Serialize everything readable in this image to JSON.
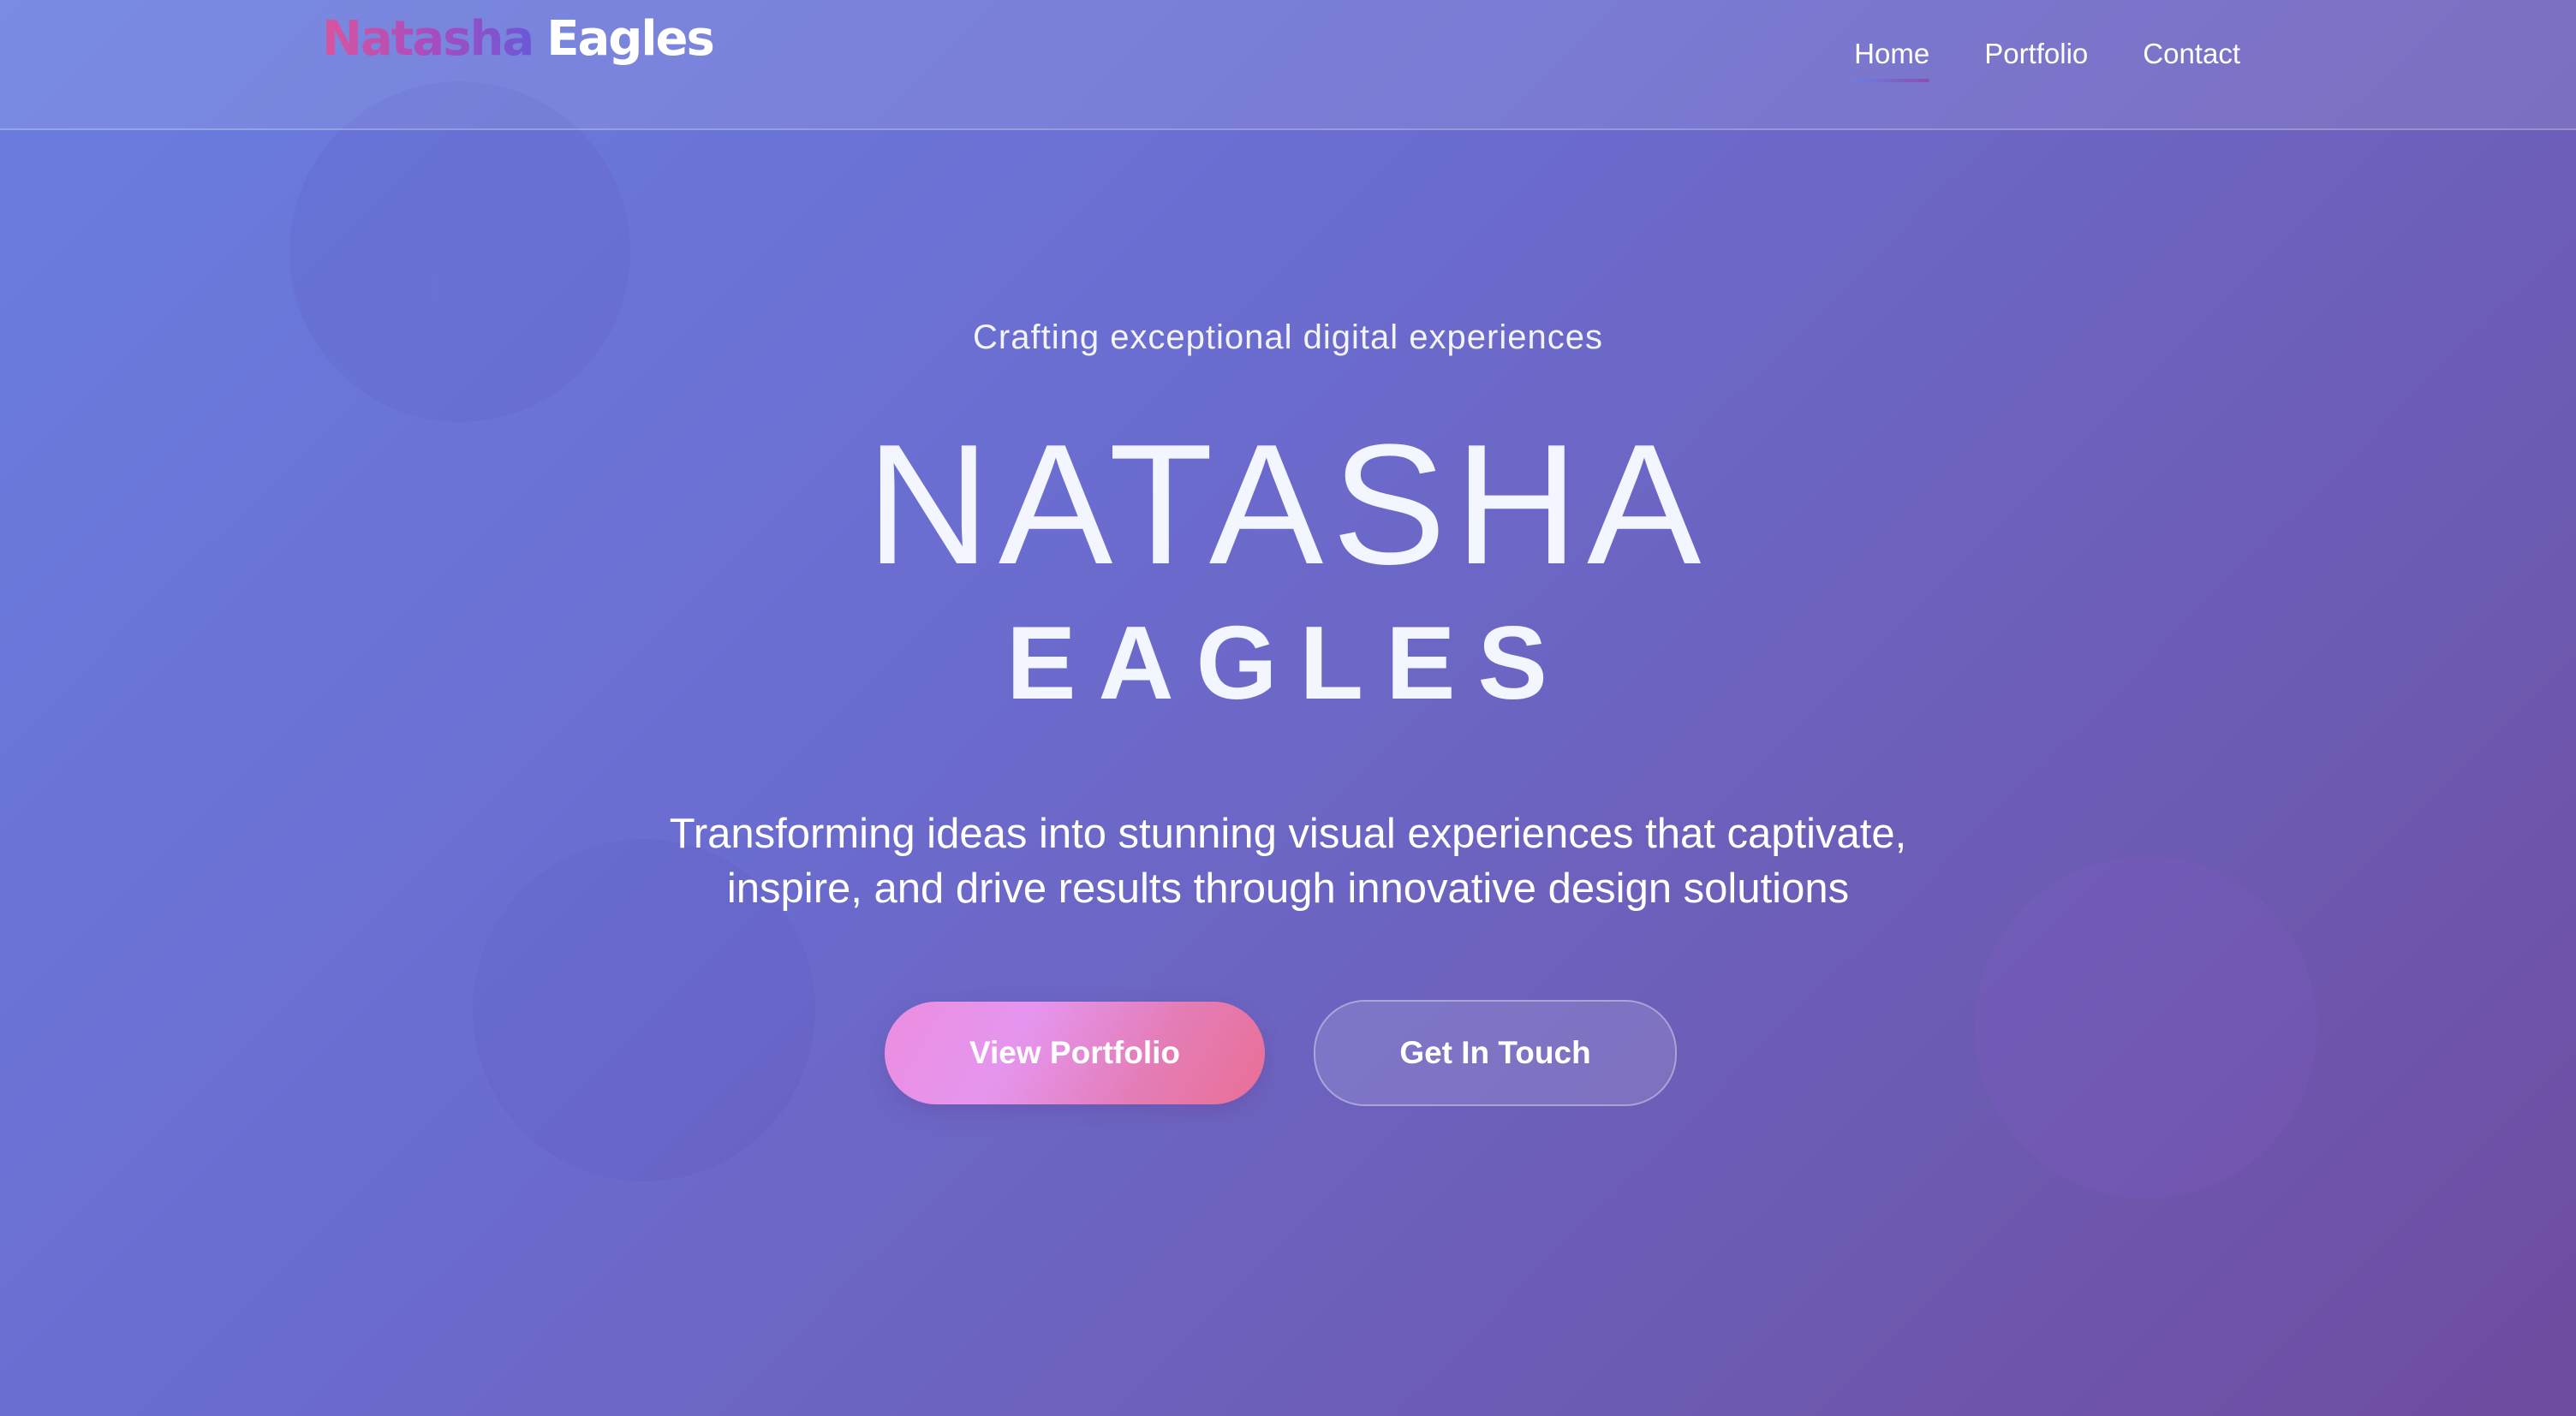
{
  "header": {
    "logo_first": "Natasha",
    "logo_last": "Eagles",
    "nav": [
      {
        "label": "Home",
        "active": true
      },
      {
        "label": "Portfolio",
        "active": false
      },
      {
        "label": "Contact",
        "active": false
      }
    ]
  },
  "hero": {
    "tagline": "Crafting exceptional digital experiences",
    "name_first": "NATASHA",
    "name_last": "EAGLES",
    "description_line1": "Transforming ideas into stunning visual experiences that captivate,",
    "description_line2": "inspire, and drive results through innovative design solutions",
    "primary_button": "View Portfolio",
    "secondary_button": "Get In Touch"
  },
  "colors": {
    "background_start": "#6a7ee0",
    "background_end": "#6e4c9f",
    "logo_gradient_start": "#d9559d",
    "logo_gradient_end": "#6a58d8",
    "primary_button_start": "#eb8ee0",
    "primary_button_end": "#e96f94",
    "text": "#ffffff"
  }
}
